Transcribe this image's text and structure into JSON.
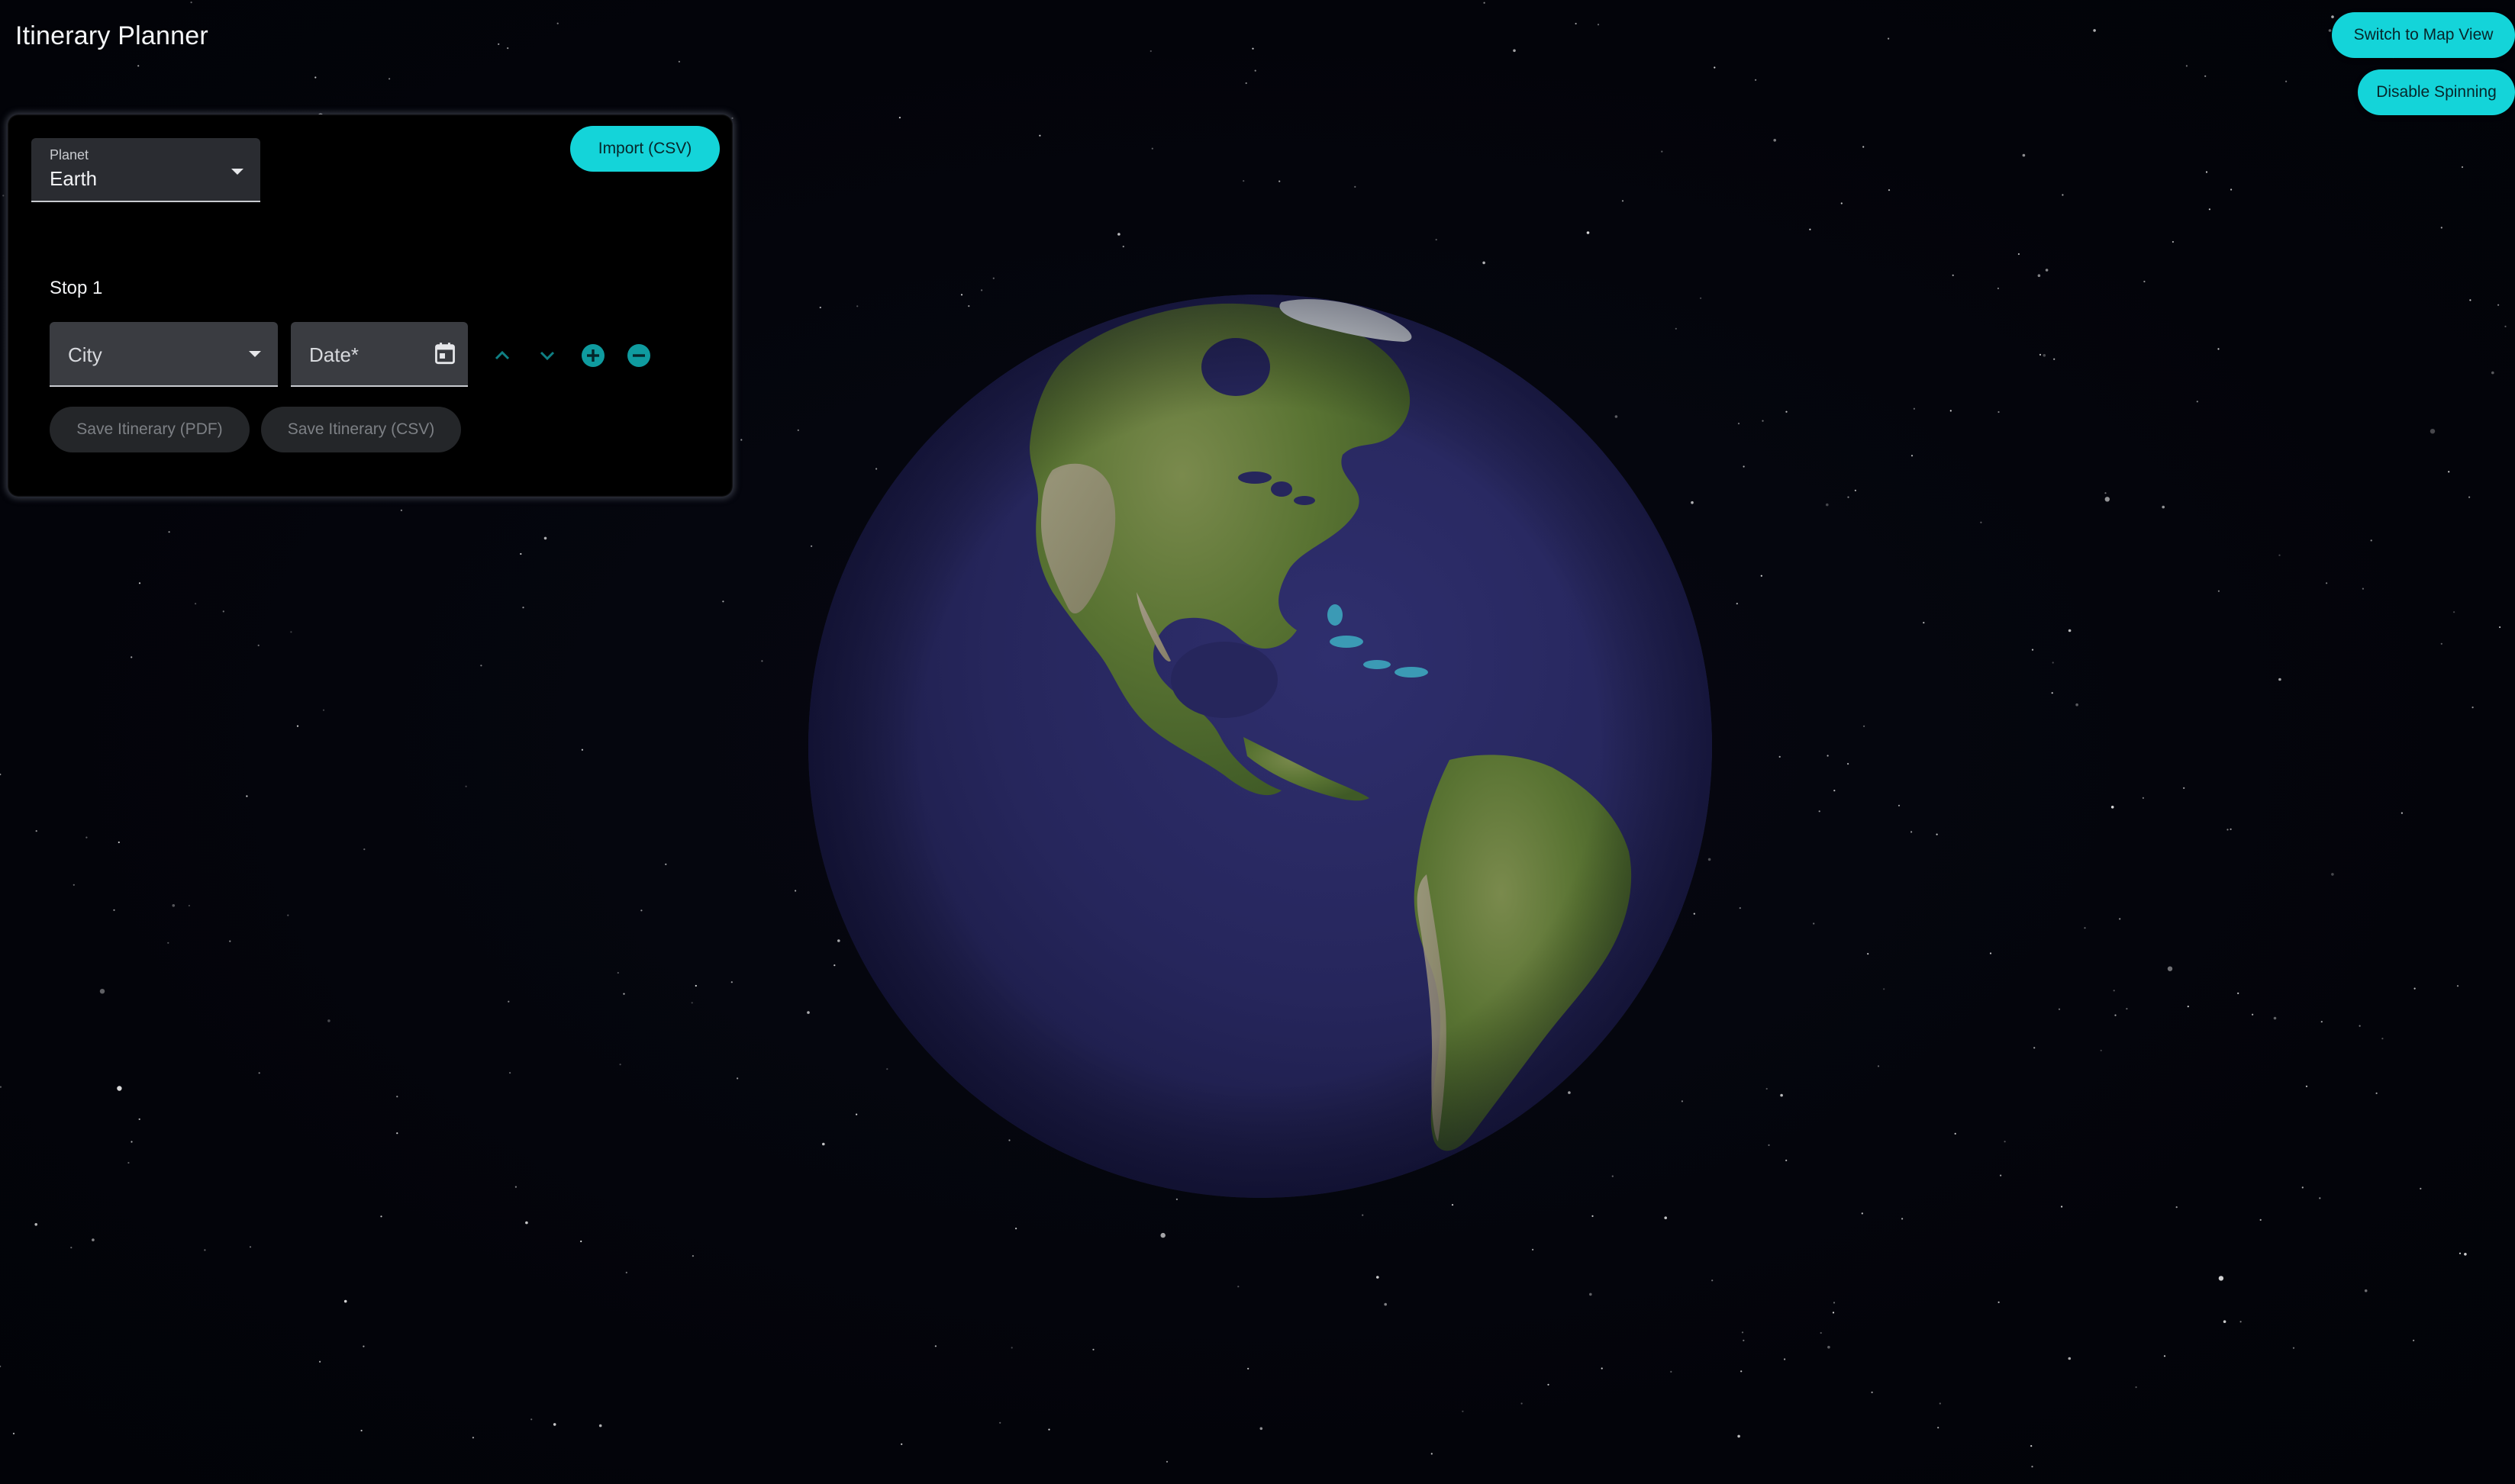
{
  "app": {
    "title": "Itinerary Planner"
  },
  "header_actions": {
    "switch_view_label": "Switch to Map View",
    "spin_label": "Disable Spinning"
  },
  "panel": {
    "planet": {
      "label": "Planet",
      "value": "Earth"
    },
    "import_label": "Import (CSV)",
    "stops": [
      {
        "title": "Stop 1",
        "city_placeholder": "City",
        "date_placeholder": "Date*"
      }
    ],
    "save_pdf_label": "Save Itinerary (PDF)",
    "save_csv_label": "Save Itinerary (CSV)"
  },
  "icons": {
    "move_up": "chevron-up-icon",
    "move_down": "chevron-down-icon",
    "add_stop": "plus-circle-icon",
    "remove_stop": "minus-circle-icon",
    "calendar": "calendar-icon",
    "dropdown": "caret-down-icon"
  },
  "colors": {
    "accent": "#14d4d9",
    "background": "#04050b",
    "panel": "#000000",
    "field": "#3a3c41",
    "disabled_button": "#242629",
    "icon_teal": "#0f9b9f",
    "atmosphere": "#2d7be6",
    "ocean": "#26265c",
    "land": "#4f6a2f"
  }
}
